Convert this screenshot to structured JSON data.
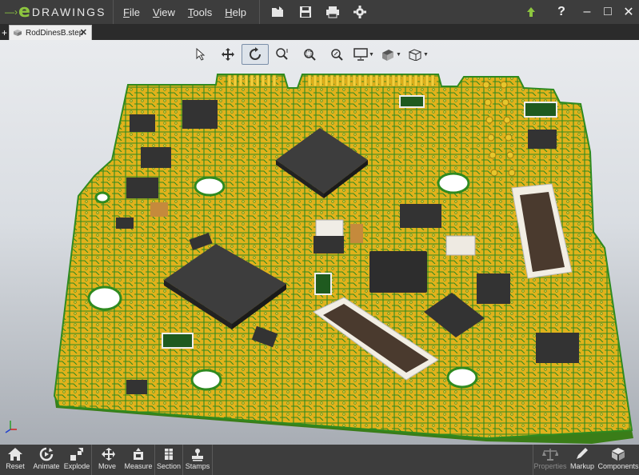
{
  "app": {
    "logo_text": "DRAWINGS",
    "logo_mark": "e"
  },
  "menu": {
    "file": "File",
    "view": "View",
    "tools": "Tools",
    "help": "Help"
  },
  "toolbar_icons": [
    "open-icon",
    "save-icon",
    "print-icon",
    "settings-icon"
  ],
  "window": {
    "help": "?",
    "minimize": "–",
    "maximize": "□",
    "close": "✕"
  },
  "tabs": {
    "add": "+",
    "active_tab": "RodDinesB.step",
    "close": "✕"
  },
  "view_toolbar": [
    "select-icon",
    "pan-icon",
    "rotate-icon",
    "zoom-area-icon",
    "zoom-fit-icon",
    "zoom-icon",
    "display-style-icon",
    "shading-icon",
    "view-orientation-icon"
  ],
  "bottom_toolbar": {
    "reset": "Reset",
    "animate": "Animate",
    "explode": "Explode",
    "move": "Move",
    "measure": "Measure",
    "section": "Section",
    "stamps": "Stamps",
    "properties": "Properties",
    "markup": "Markup",
    "components": "Components"
  },
  "colors": {
    "board": "#e1b21c",
    "board_edge": "#3a8a1a",
    "chip": "#3b3b3b",
    "brand_green": "#8dc63f"
  }
}
